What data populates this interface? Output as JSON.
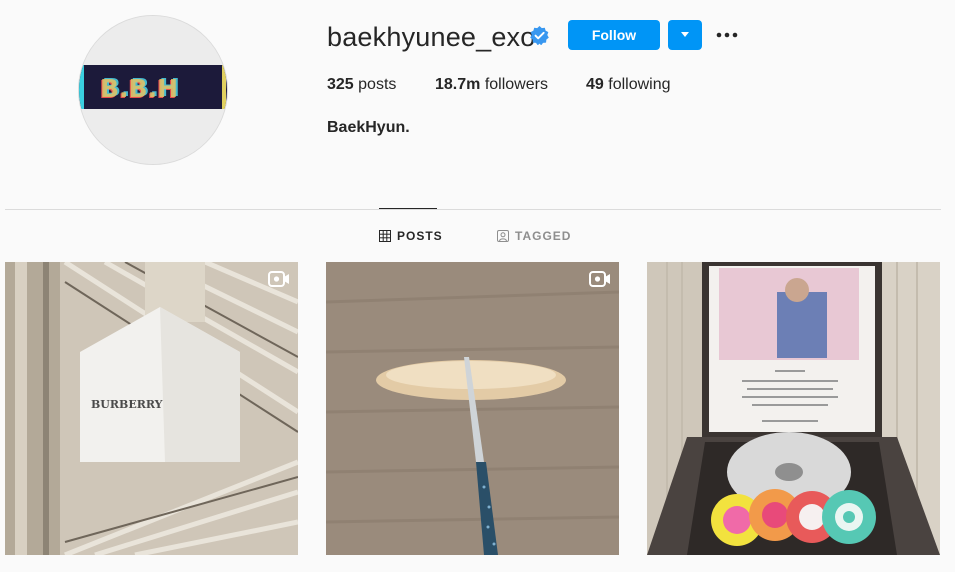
{
  "profile": {
    "username": "baekhyunee_exo",
    "verified": true,
    "full_name": "BaekHyun.",
    "avatar_text": "B.B.H",
    "stats": {
      "posts_count": "325",
      "posts_label": " posts",
      "followers_count": "18.7m",
      "followers_label": " followers",
      "following_count": "49",
      "following_label": " following"
    }
  },
  "actions": {
    "follow_label": "Follow",
    "dropdown_icon": "chevron-down-icon",
    "more_icon": "more-options-icon"
  },
  "tabs": [
    {
      "label": "POSTS",
      "icon": "grid-icon",
      "active": true
    },
    {
      "label": "TAGGED",
      "icon": "tagged-icon",
      "active": false
    }
  ],
  "posts_text": {
    "post1_brand": "BURBERRY"
  },
  "colors": {
    "accent": "#0095f6",
    "verified": "#3897f0",
    "text": "#262626",
    "muted": "#8e8e8e",
    "background": "#fafafa",
    "divider": "#dbdbdb"
  }
}
